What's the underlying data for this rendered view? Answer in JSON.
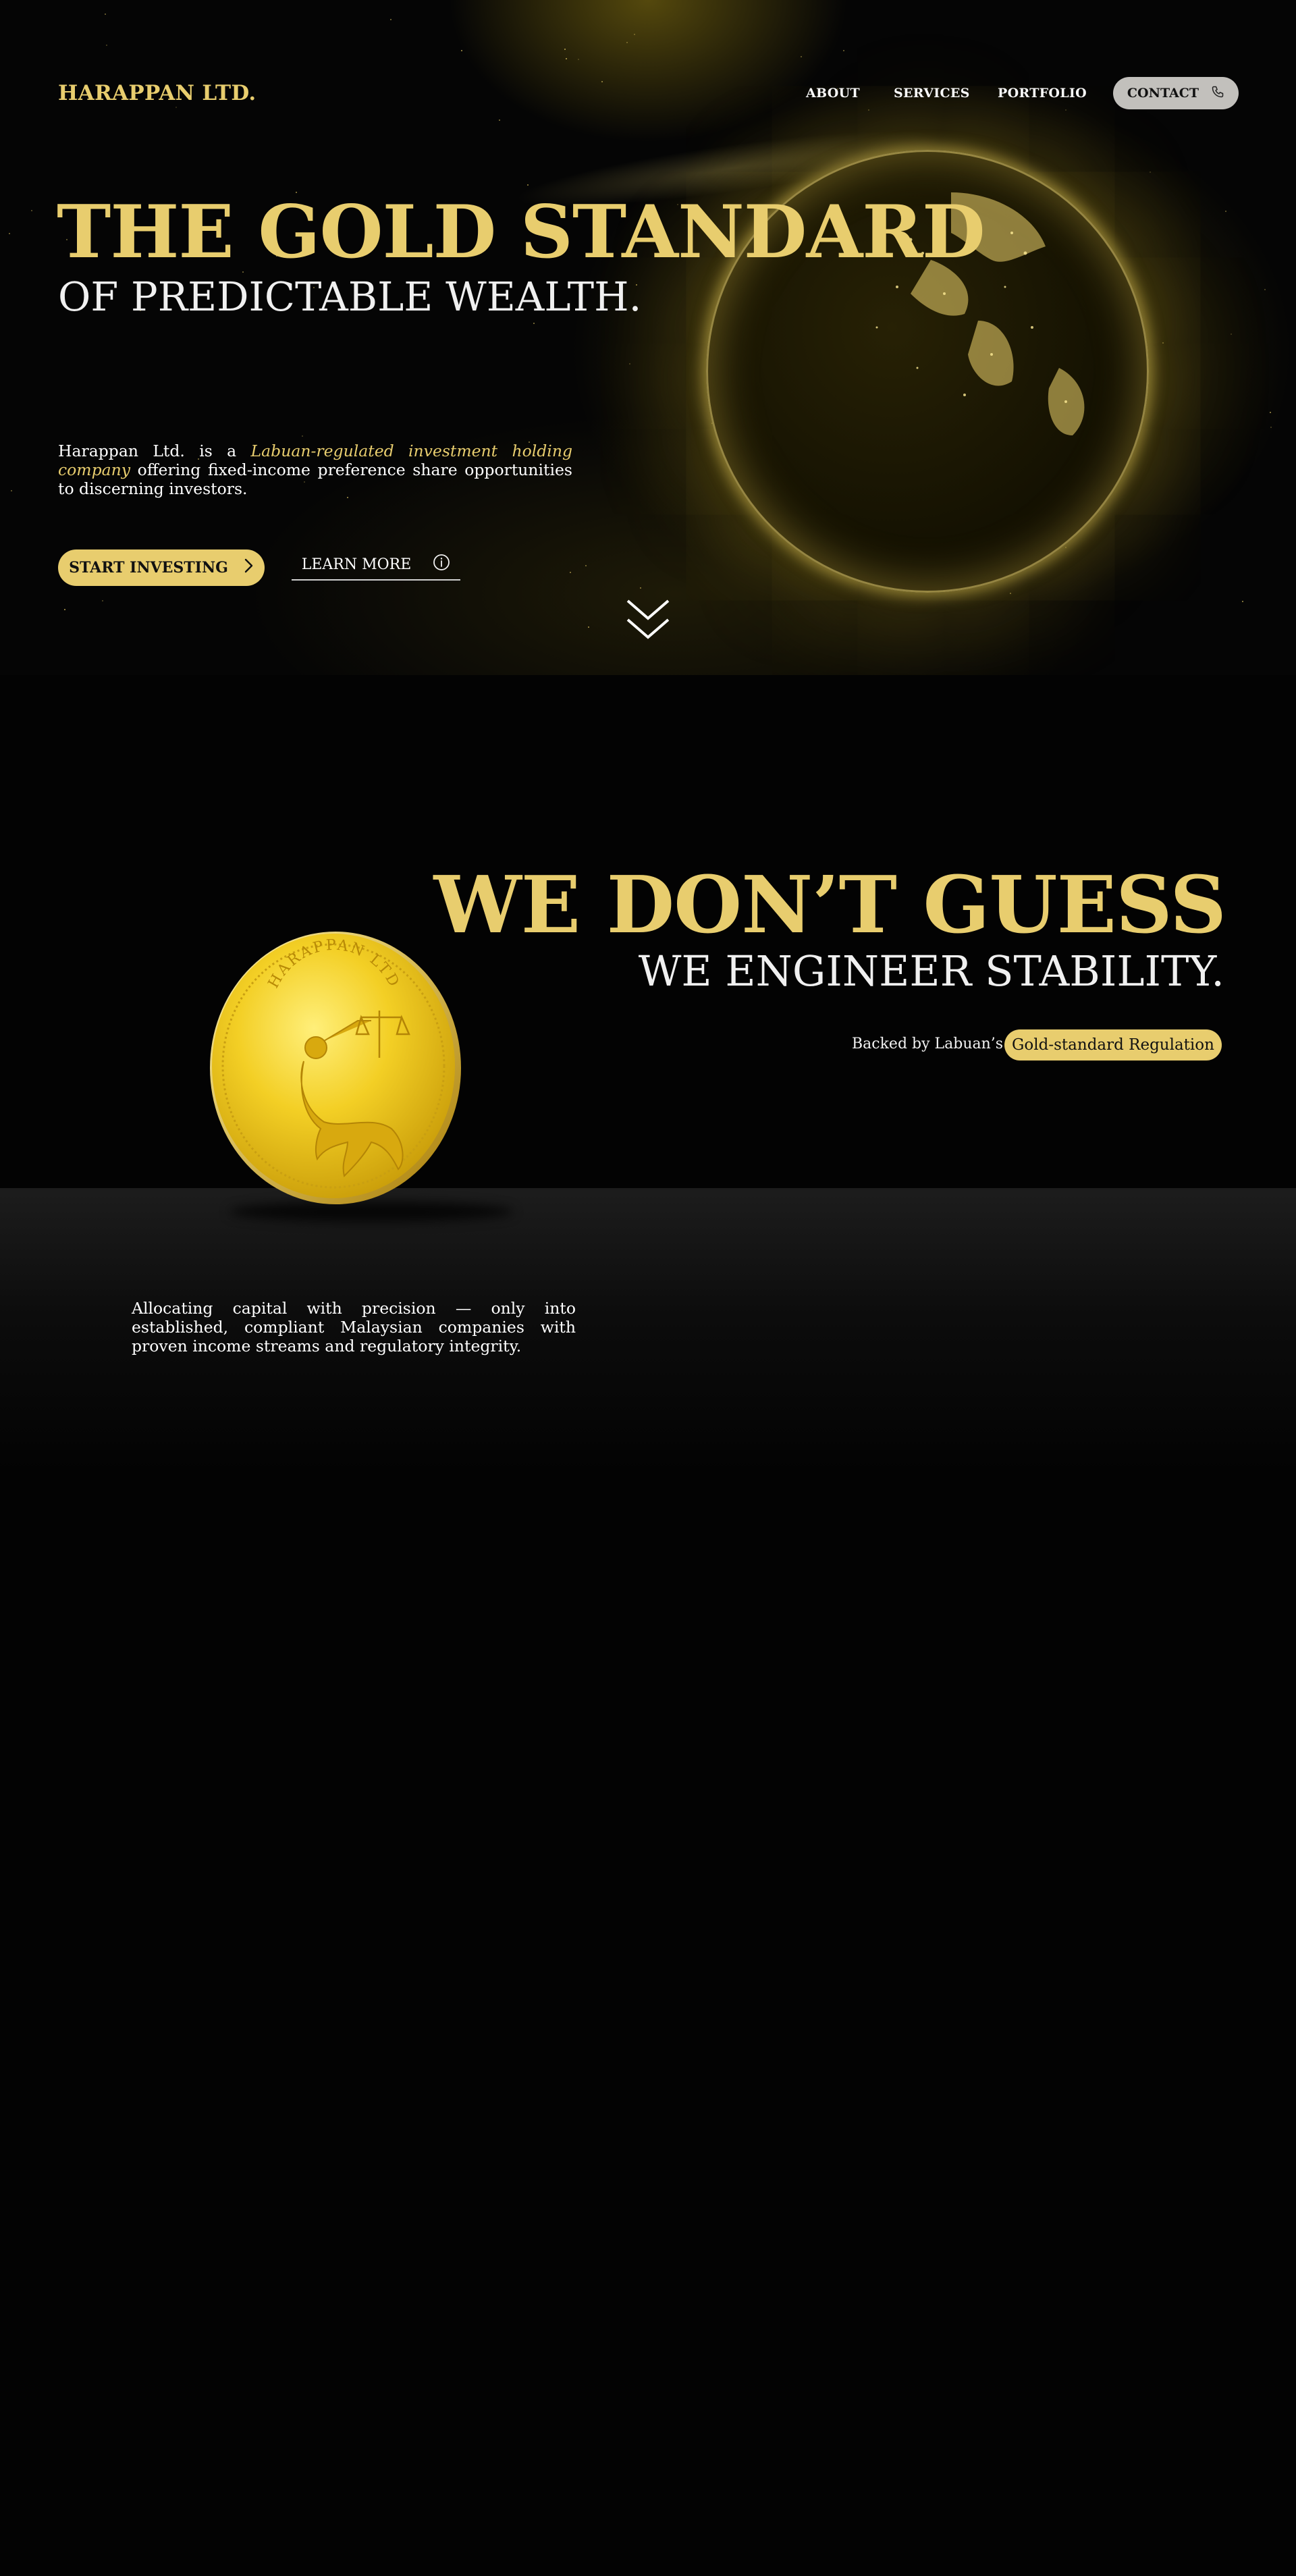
{
  "brand": "HARAPPAN LTD.",
  "nav": {
    "about": "ABOUT",
    "services": "SERVICES",
    "portfolio": "PORTFOLIO",
    "contact": "CONTACT"
  },
  "hero": {
    "title": "THE GOLD STANDARD",
    "subtitle": "OF PREDICTABLE WEALTH.",
    "lead_pre": "Harappan Ltd. is a ",
    "lead_em": "Labuan-regulated investment holding company",
    "lead_post": " offering fixed-income preference share opportunities to discerning investors.",
    "start_label": "START INVESTING",
    "learn_label": "LEARN MORE"
  },
  "section2": {
    "title": "WE DON’T GUESS",
    "subtitle": "WE ENGINEER STABILITY.",
    "backed_text": "Backed by Labuan’s",
    "badge": "Gold-standard Regulation",
    "coin_text": "HARAPPAN LTD",
    "body": "Allocating capital with precision — only into established, compliant Malaysian companies with proven income streams and regulatory integrity."
  },
  "icons": {
    "contact": "phone-icon",
    "start": "chevron-right-icon",
    "learn": "info-icon",
    "scroll": "double-chevron-down-icon"
  },
  "colors": {
    "gold": "#e8cd6e",
    "background": "#030303",
    "contact_button": "#c2c0bc"
  }
}
